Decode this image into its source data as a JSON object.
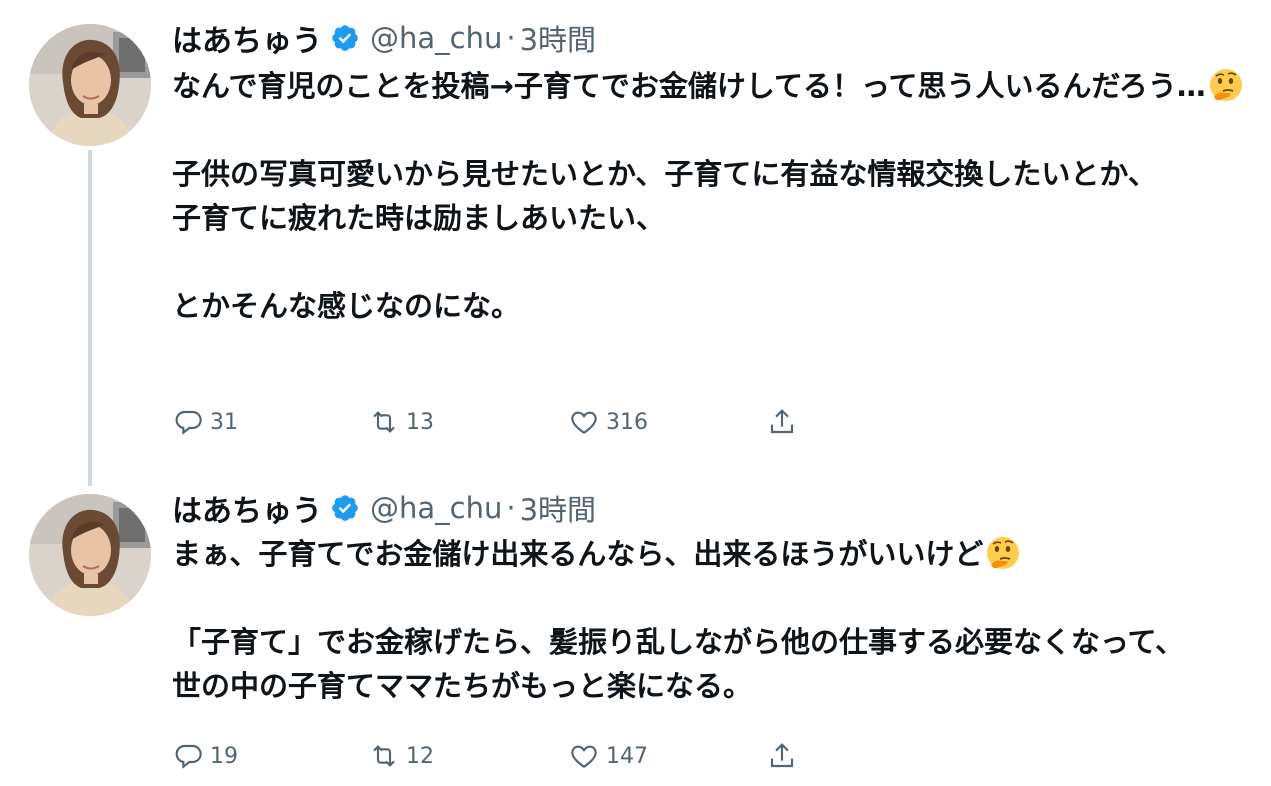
{
  "tweets": [
    {
      "display_name": "はあちゅう",
      "handle": "@ha_chu",
      "separator": "·",
      "time": "3時間",
      "text": "なんで育児のことを投稿→子育てでお金儲けしてる！って思う人いるんだろう…",
      "text_after_emoji": "\n\n子供の写真可愛いから見せたいとか、子育てに有益な情報交換したいとか、\n子育てに疲れた時は励ましあいたい、\n\nとかそんな感じなのにな。",
      "emoji": "thinking-face-icon",
      "replies": "31",
      "retweets": "13",
      "likes": "316"
    },
    {
      "display_name": "はあちゅう",
      "handle": "@ha_chu",
      "separator": "·",
      "time": "3時間",
      "text": "まぁ、子育てでお金儲け出来るんなら、出来るほうがいいけど",
      "text_after_emoji": "\n\n「子育て」でお金稼げたら、髪振り乱しながら他の仕事する必要なくなって、\n世の中の子育てママたちがもっと楽になる。",
      "emoji": "thinking-face-icon",
      "replies": "19",
      "retweets": "12",
      "likes": "147"
    }
  ],
  "icons": {
    "reply": "reply-icon",
    "retweet": "retweet-icon",
    "like": "heart-icon",
    "share": "share-icon",
    "verified": "verified-badge-icon"
  },
  "colors": {
    "verified": "#1d9bf0",
    "secondary_text": "#536471",
    "thread_line": "#cfd9de"
  }
}
